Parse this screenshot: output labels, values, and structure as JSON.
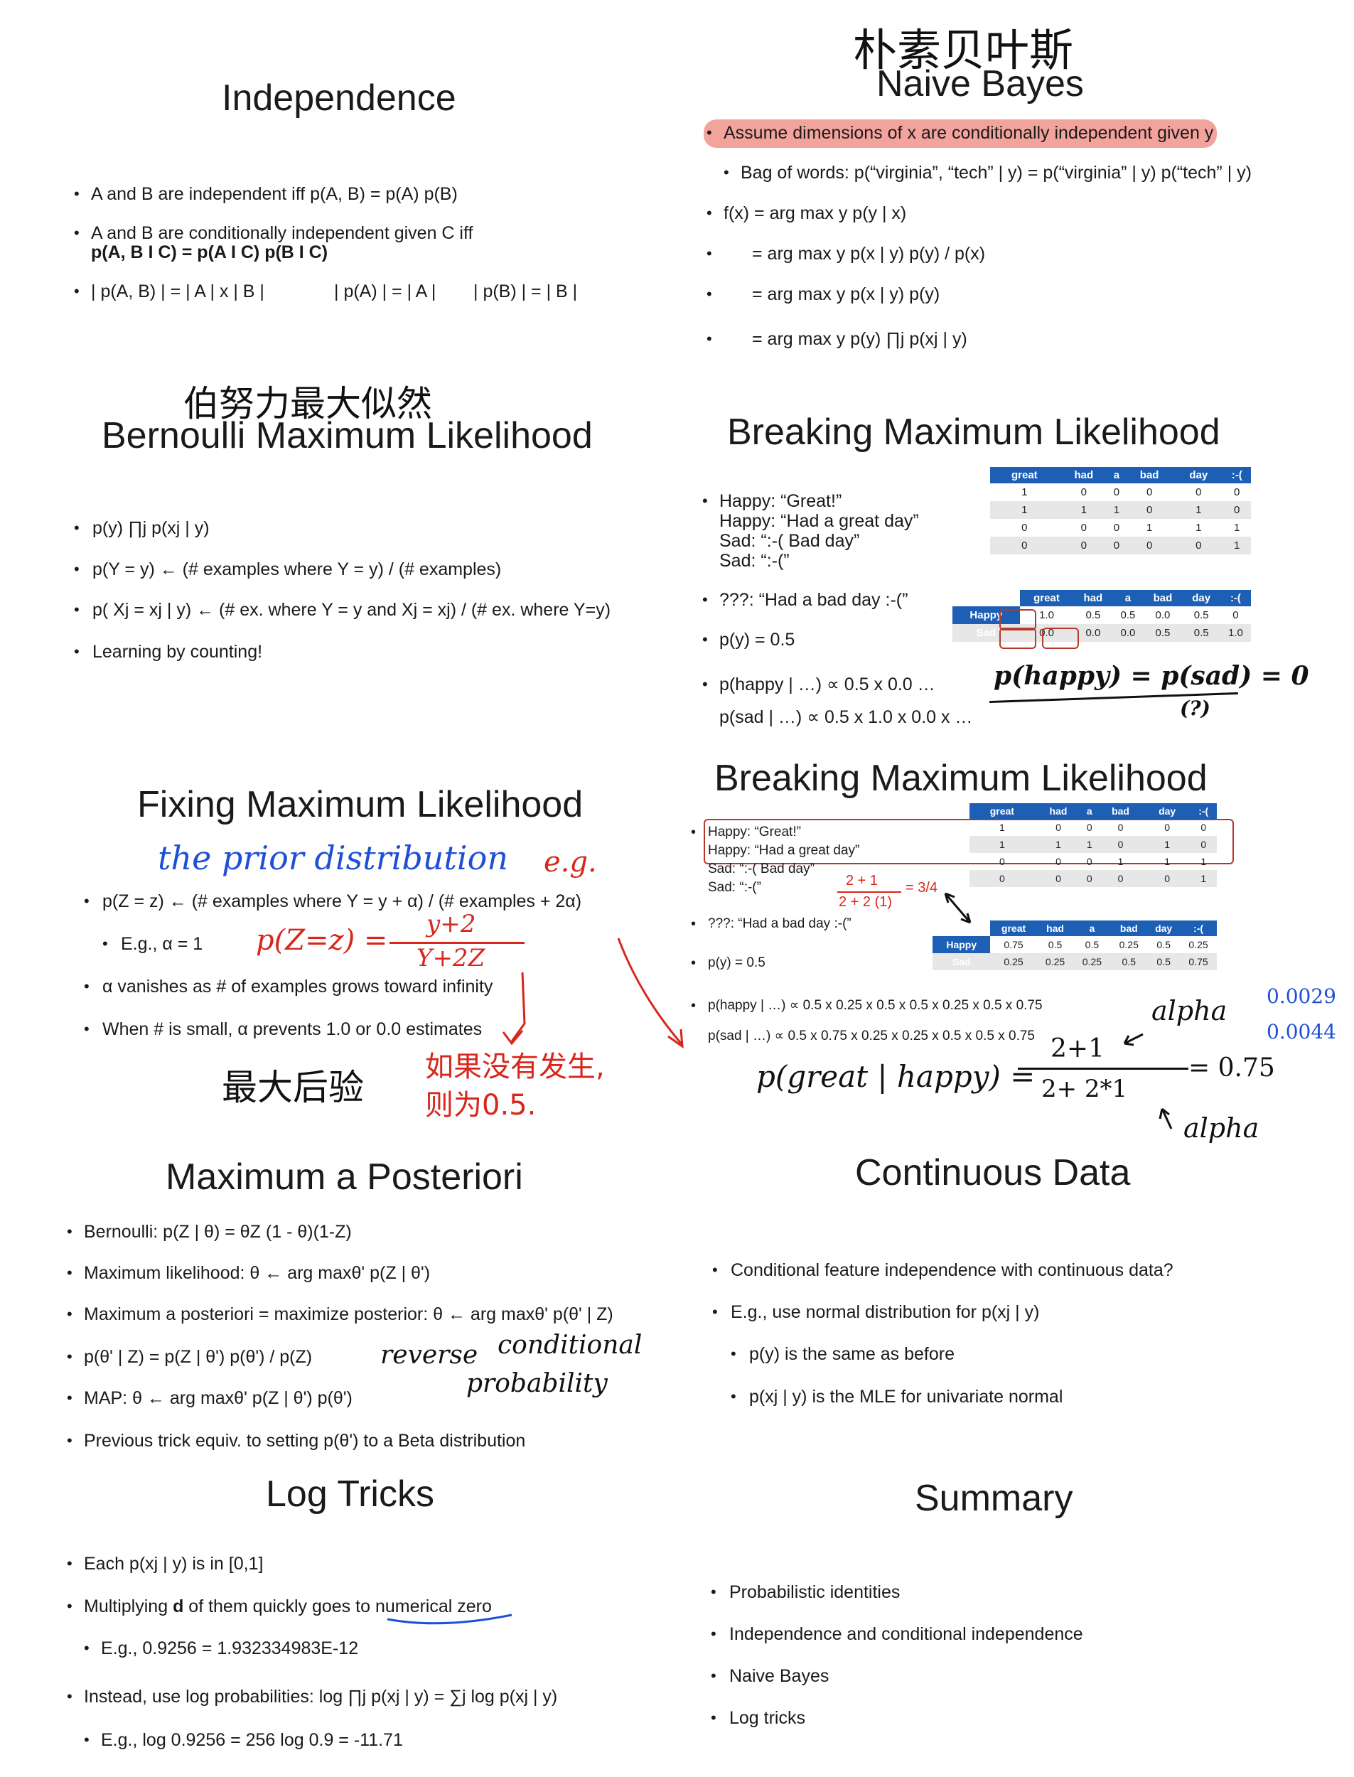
{
  "slide1": {
    "title": "Independence",
    "b1": "A and B are independent iff p(A, B) = p(A) p(B)",
    "b2a": "A and B are conditionally independent given C iff",
    "b2b": "p(A, B I C) = p(A I C) p(B I C)",
    "b3a": "| p(A, B) | = | A | x | B |",
    "b3b": "| p(A) | = | A |",
    "b3c": "| p(B) | = | B |"
  },
  "slide2": {
    "handwritten_title": "朴素贝叶斯",
    "title": "Naive Bayes",
    "b1": "Assume dimensions of x are conditionally independent given y",
    "b2": "Bag of words: p(“virginia”, “tech” | y) = p(“virginia” | y) p(“tech” | y)",
    "b3": "f(x) = arg max y p(y | x)",
    "b4": "= arg max y p(x | y) p(y) / p(x)",
    "b5": "= arg max y p(x | y) p(y)",
    "b6": "= arg max y p(y) ∏j p(xj | y)"
  },
  "slide3": {
    "handwritten_title": "伯努力最大似然",
    "title": "Bernoulli Maximum Likelihood",
    "b1": "p(y) ∏j p(xj | y)",
    "b2": "p(Y = y) ← (# examples where Y = y) / (# examples)",
    "b3": "p( Xj = xj | y) ← (# ex. where Y = y and Xj = xj) / (# ex. where Y=y)",
    "b4": "Learning by counting!"
  },
  "slide4": {
    "title": "Breaking Maximum Likelihood",
    "examples": [
      "Happy: “Great!”",
      "Happy: “Had a great day”",
      "Sad: “:-( Bad day”",
      "Sad: “:-(”"
    ],
    "query": "???: “Had a bad day :-(”",
    "py": "p(y) = 0.5",
    "phappy": "p(happy | …) ∝ 0.5 x 0.0 …",
    "psad": "p(sad | …)     ∝ 0.5 x 1.0 x 0.0 x …",
    "table1": {
      "headers": [
        "great",
        "had",
        "a",
        "bad",
        "day",
        ":-("
      ],
      "rows": [
        [
          "1",
          "0",
          "0",
          "0",
          "0",
          "0"
        ],
        [
          "1",
          "1",
          "1",
          "0",
          "1",
          "0"
        ],
        [
          "0",
          "0",
          "0",
          "1",
          "1",
          "1"
        ],
        [
          "0",
          "0",
          "0",
          "0",
          "0",
          "1"
        ]
      ]
    },
    "table2": {
      "headers": [
        "great",
        "had",
        "a",
        "bad",
        "day",
        ":-("
      ],
      "rows": [
        {
          "label": "Happy",
          "cells": [
            "1.0",
            "0.5",
            "0.5",
            "0.0",
            "0.5",
            "0"
          ]
        },
        {
          "label": "Sad",
          "cells": [
            "0.0",
            "0.0",
            "0.0",
            "0.5",
            "0.5",
            "1.0"
          ]
        }
      ]
    },
    "hw_note": "p(happy) = p(sad) = 0",
    "hw_q": "(?)"
  },
  "slide5": {
    "title": "Fixing Maximum Likelihood",
    "hw_prior": "the prior distribution",
    "hw_eg": "e.g.",
    "b1": "p(Z = z) ← (# examples where Y = y + α) / (# examples + 2α)",
    "b2": "E.g., α = 1",
    "hw_formula_left": "p(Z=z) =",
    "hw_formula_num": "y+2",
    "hw_formula_den": "Y+2Z",
    "b3": "α vanishes as # of examples grows toward infinity",
    "b4": "When # is small, α prevents 1.0 or 0.0 estimates",
    "hw_map": "最大后验",
    "hw_note1": "如果没有发生,",
    "hw_note2": "则为0.5."
  },
  "slide6": {
    "title": "Breaking Maximum Likelihood",
    "examples": [
      "Happy: “Great!”",
      "Happy: “Had a great day”",
      "Sad: “:-( Bad day”",
      "Sad: “:-(”"
    ],
    "frac_num": "2 + 1",
    "frac_den": "2 + 2 (1)",
    "frac_eq": "= 3/4",
    "query": "???: “Had a bad day :-(”",
    "py": "p(y) = 0.5",
    "phappy": "p(happy | …) ∝ 0.5 x 0.25 x 0.5 x 0.5 x 0.25 x 0.5 x 0.75",
    "psad": "p(sad | …)     ∝ 0.5 x 0.75 x 0.25 x 0.25 x 0.5 x 0.5 x 0.75",
    "table1": {
      "headers": [
        "great",
        "had",
        "a",
        "bad",
        "day",
        ":-("
      ],
      "rows": [
        [
          "1",
          "0",
          "0",
          "0",
          "0",
          "0"
        ],
        [
          "1",
          "1",
          "1",
          "0",
          "1",
          "0"
        ],
        [
          "0",
          "0",
          "0",
          "1",
          "1",
          "1"
        ],
        [
          "0",
          "0",
          "0",
          "0",
          "0",
          "1"
        ]
      ]
    },
    "table2": {
      "headers": [
        "great",
        "had",
        "a",
        "bad",
        "day",
        ":-("
      ],
      "rows": [
        {
          "label": "Happy",
          "cells": [
            "0.75",
            "0.5",
            "0.5",
            "0.25",
            "0.5",
            "0.25"
          ]
        },
        {
          "label": "Sad",
          "cells": [
            "0.25",
            "0.25",
            "0.25",
            "0.5",
            "0.5",
            "0.75"
          ]
        }
      ]
    },
    "hw_v1": "0.0029",
    "hw_v2": "0.0044",
    "hw_alpha1": "alpha",
    "hw_alpha2": "alpha",
    "hw_p": "p(great | happy) =",
    "hw_num": "2+1",
    "hw_den": "2+ 2*1",
    "hw_res": "= 0.75"
  },
  "slide7": {
    "title": "Maximum a Posteriori",
    "b1": "Bernoulli: p(Z | θ) = θZ (1 - θ)(1-Z)",
    "b2": "Maximum likelihood: θ ← arg maxθ' p(Z | θ')",
    "b3": "Maximum a posteriori = maximize posterior: θ ← arg maxθ' p(θ' | Z)",
    "b4": "p(θ' | Z) = p(Z | θ') p(θ') / p(Z)",
    "b5": "MAP: θ ← arg maxθ' p(Z | θ') p(θ')",
    "b6": "Previous trick equiv. to setting p(θ') to a Beta distribution",
    "hw1": "reverse",
    "hw2": "conditional",
    "hw3": "probability"
  },
  "slide8": {
    "title": "Continuous Data",
    "b1": "Conditional feature independence with continuous data?",
    "b2": "E.g., use normal distribution for p(xj | y)",
    "b3": "p(y) is the same as before",
    "b4": "p(xj | y) is the MLE for univariate normal"
  },
  "slide9": {
    "title": "Log Tricks",
    "b1": "Each p(xj | y) is in [0,1]",
    "b2a": "Multiplying ",
    "b2b": "d",
    "b2c": " of them quickly goes to ",
    "b2d": "numerical zero",
    "b3": "E.g., 0.9256 = 1.932334983E-12",
    "b4": "Instead, use log probabilities: log ∏j p(xj | y) = ∑j log p(xj | y)",
    "b5": "E.g., log 0.9256 = 256 log 0.9 = -11.71"
  },
  "slide10": {
    "title": "Summary",
    "items": [
      "Probabilistic identities",
      "Independence and conditional independence",
      "Naive Bayes",
      "Log tricks"
    ]
  }
}
